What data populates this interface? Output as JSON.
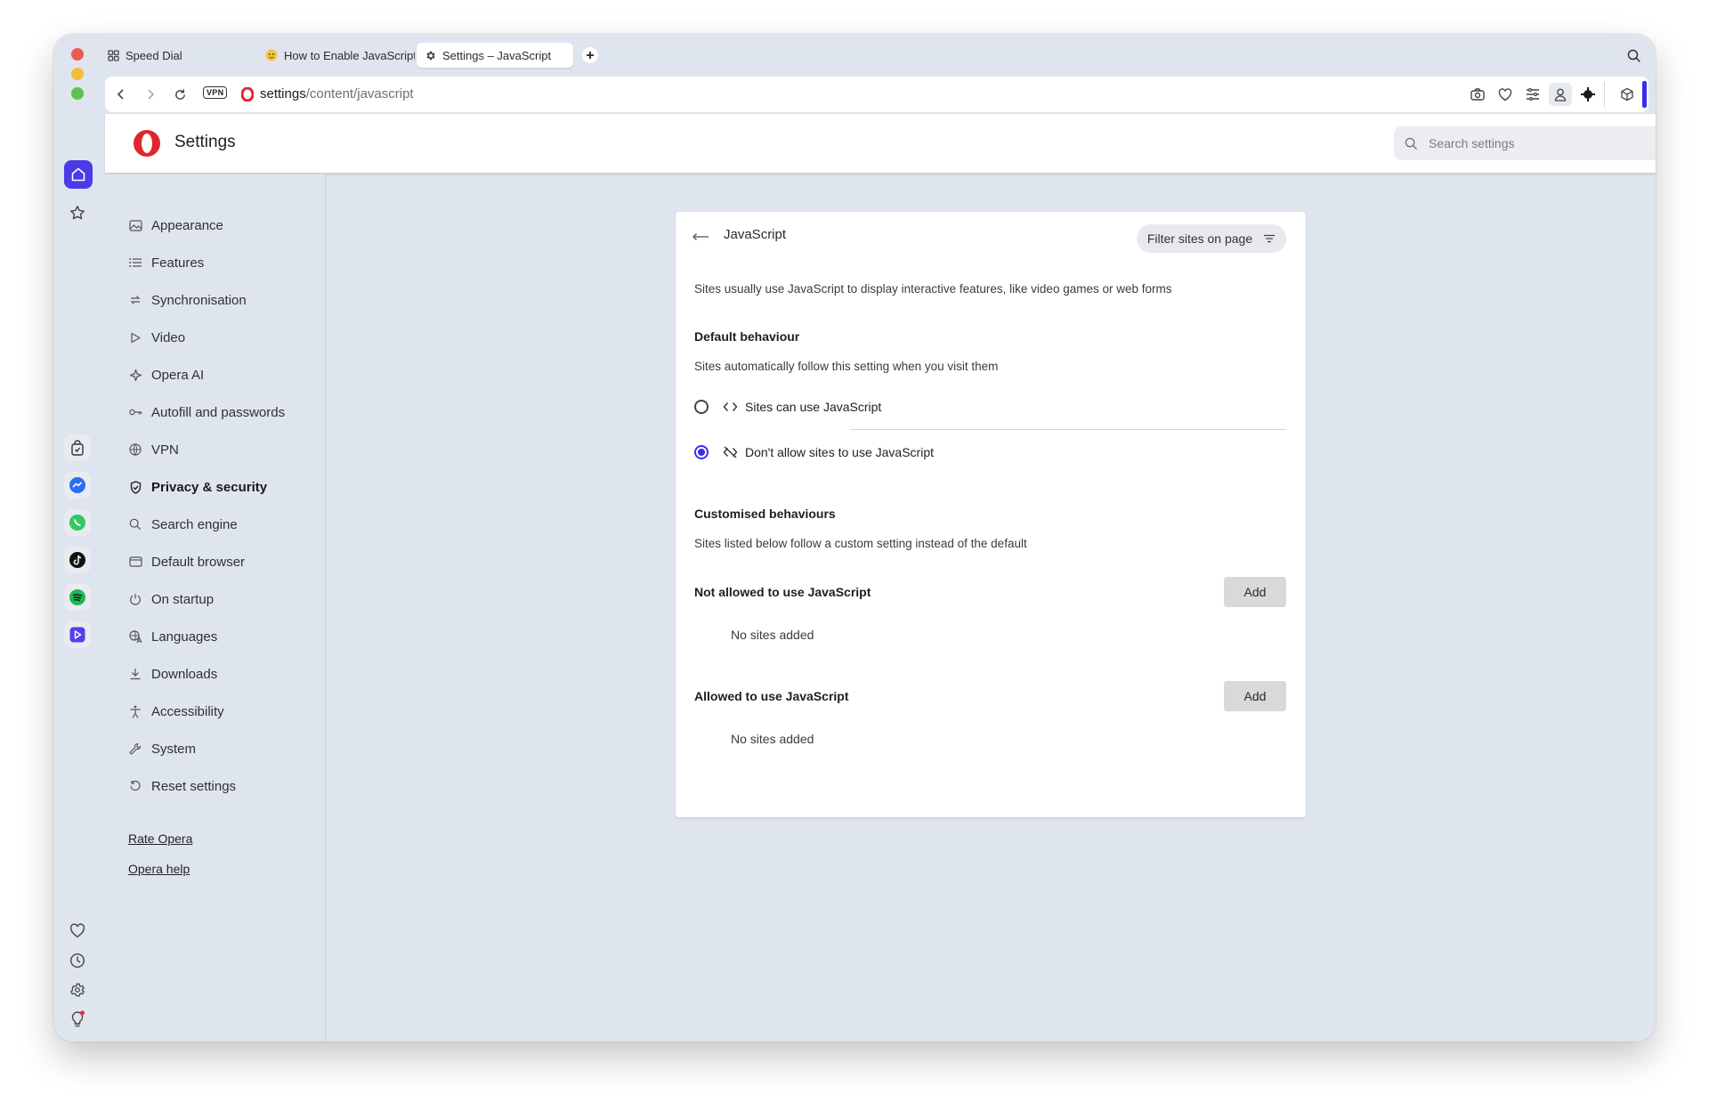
{
  "tabs": [
    {
      "label": "Speed Dial",
      "icon": "grid-icon"
    },
    {
      "label": "How to Enable JavaScript",
      "icon": "emoji-favicon-icon"
    },
    {
      "label": "Settings – JavaScript",
      "icon": "gear-icon"
    }
  ],
  "address_bar": {
    "host": "settings",
    "path": "/content/javascript",
    "vpn_badge": "VPN"
  },
  "header": {
    "title": "Settings",
    "search_placeholder": "Search settings"
  },
  "nav": {
    "items": [
      {
        "label": "Appearance",
        "icon": "image-icon"
      },
      {
        "label": "Features",
        "icon": "list-icon"
      },
      {
        "label": "Synchronisation",
        "icon": "sync-icon"
      },
      {
        "label": "Video",
        "icon": "play-icon"
      },
      {
        "label": "Opera AI",
        "icon": "sparkle-icon"
      },
      {
        "label": "Autofill and passwords",
        "icon": "key-icon"
      },
      {
        "label": "VPN",
        "icon": "globe-icon"
      },
      {
        "label": "Privacy & security",
        "icon": "shield-check-icon",
        "active": true
      },
      {
        "label": "Search engine",
        "icon": "search-icon"
      },
      {
        "label": "Default browser",
        "icon": "browser-window-icon"
      },
      {
        "label": "On startup",
        "icon": "power-icon"
      },
      {
        "label": "Languages",
        "icon": "translate-icon"
      },
      {
        "label": "Downloads",
        "icon": "download-icon"
      },
      {
        "label": "Accessibility",
        "icon": "accessibility-icon"
      },
      {
        "label": "System",
        "icon": "wrench-icon"
      },
      {
        "label": "Reset settings",
        "icon": "reset-icon"
      }
    ],
    "links": [
      "Rate Opera",
      "Opera help"
    ]
  },
  "card": {
    "title": "JavaScript",
    "filter_label": "Filter sites on page",
    "intro": "Sites usually use JavaScript to display interactive features, like video games or web forms",
    "default_heading": "Default behaviour",
    "default_desc": "Sites automatically follow this setting when you visit them",
    "options": [
      {
        "label": "Sites can use JavaScript",
        "selected": false,
        "icon": "code-icon"
      },
      {
        "label": "Don't allow sites to use JavaScript",
        "selected": true,
        "icon": "code-off-icon"
      }
    ],
    "custom_heading": "Customised behaviours",
    "custom_desc": "Sites listed below follow a custom setting instead of the default",
    "blocked": {
      "title": "Not allowed to use JavaScript",
      "add": "Add",
      "empty": "No sites added"
    },
    "allowed": {
      "title": "Allowed to use JavaScript",
      "add": "Add",
      "empty": "No sites added"
    }
  },
  "colors": {
    "accent": "#3b2ee8",
    "window_bg": "#dfe5ee",
    "opera_red": "#e0262f"
  }
}
